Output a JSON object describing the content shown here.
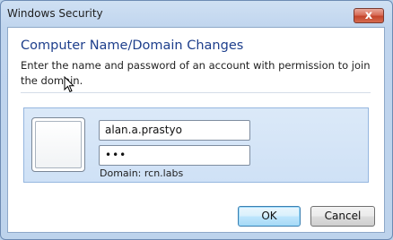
{
  "window": {
    "title": "Windows Security",
    "close_glyph": "x"
  },
  "dialog": {
    "heading": "Computer Name/Domain Changes",
    "description": "Enter the name and password of an account with permission to join the domain."
  },
  "credentials": {
    "tile_icon": "user-tile-icon",
    "username_value": "alan.a.prastyo",
    "password_value": "•••",
    "domain_text": "Domain: rcn.labs"
  },
  "buttons": {
    "ok_label": "OK",
    "cancel_label": "Cancel"
  },
  "colors": {
    "heading": "#1e3f8c",
    "close_button": "#c4452c",
    "credential_panel": "#dbe9f8"
  }
}
